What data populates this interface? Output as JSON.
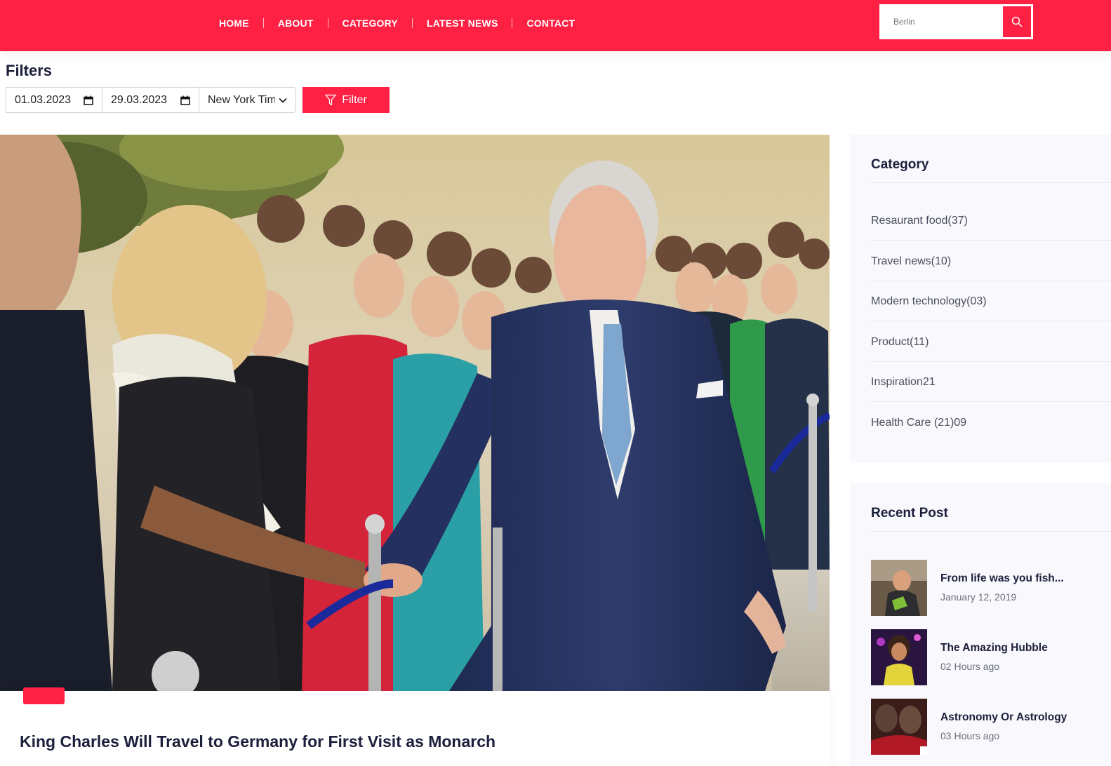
{
  "nav": {
    "items": [
      {
        "label": "HOME"
      },
      {
        "label": "ABOUT"
      },
      {
        "label": "CATEGORY"
      },
      {
        "label": "LATEST NEWS"
      },
      {
        "label": "CONTACT"
      }
    ]
  },
  "search": {
    "placeholder": "Berlin",
    "icon": "search-icon"
  },
  "filters": {
    "title": "Filters",
    "date_from": "01.03.2023",
    "date_to": "29.03.2023",
    "source_selected": "New York Times",
    "button_label": "Filter"
  },
  "featured": {
    "title": "King Charles Will Travel to Germany for First Visit as Monarch"
  },
  "sidebar": {
    "category": {
      "heading": "Category",
      "items": [
        {
          "label": "Resaurant food(37)"
        },
        {
          "label": "Travel news(10)"
        },
        {
          "label": "Modern technology(03)"
        },
        {
          "label": "Product(11)"
        },
        {
          "label": "Inspiration21"
        },
        {
          "label": "Health Care (21)09"
        }
      ]
    },
    "recent": {
      "heading": "Recent Post",
      "posts": [
        {
          "title": "From life was you fish...",
          "date": "January 12, 2019"
        },
        {
          "title": "The Amazing Hubble",
          "date": "02 Hours ago"
        },
        {
          "title": "Astronomy Or Astrology",
          "date": "03 Hours ago"
        }
      ]
    }
  },
  "colors": {
    "brand": "#fe2144",
    "heading": "#1b1f3b",
    "sidebar_bg": "#f8f8fd"
  }
}
